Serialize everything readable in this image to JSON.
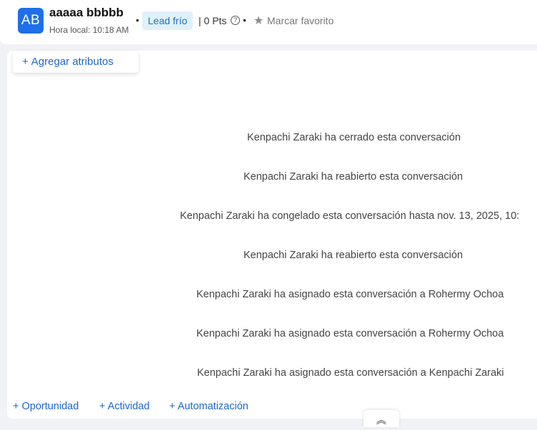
{
  "header": {
    "avatar_initials": "AB",
    "contact_name": "aaaaa bbbbb",
    "local_time": "Hora local: 10:18 AM",
    "separator": "•",
    "lead_status": "Lead frío",
    "points": "| 0 Pts",
    "help_glyph": "?",
    "star_glyph": "★",
    "favorite_label": "Marcar favorito"
  },
  "panel": {
    "add_attributes_plus": "+",
    "add_attributes_label": "Agregar atributos",
    "events": [
      "Kenpachi Zaraki ha cerrado esta conversación",
      "Kenpachi Zaraki ha reabierto esta conversación",
      "Kenpachi Zaraki ha congelado esta conversación hasta nov. 13, 2025, 10:",
      "Kenpachi Zaraki ha reabierto esta conversación",
      "Kenpachi Zaraki ha asignado esta conversación a Rohermy Ochoa",
      "Kenpachi Zaraki ha asignado esta conversación a Rohermy Ochoa",
      "Kenpachi Zaraki ha asignado esta conversación a Kenpachi Zaraki"
    ],
    "actions": {
      "opportunity": "+ Oportunidad",
      "activity": "+ Actividad",
      "automation": "+ Automatización"
    },
    "collapse_glyph": "︽"
  },
  "colors": {
    "accent": "#1e66c8",
    "avatar_bg": "#1f6fe8",
    "lead_badge_bg": "#dff1fb",
    "page_bg": "#f1f2f5"
  },
  "icons": {
    "help": "question-circle-icon",
    "favorite": "star-icon",
    "collapse": "double-chevron-up-icon"
  }
}
